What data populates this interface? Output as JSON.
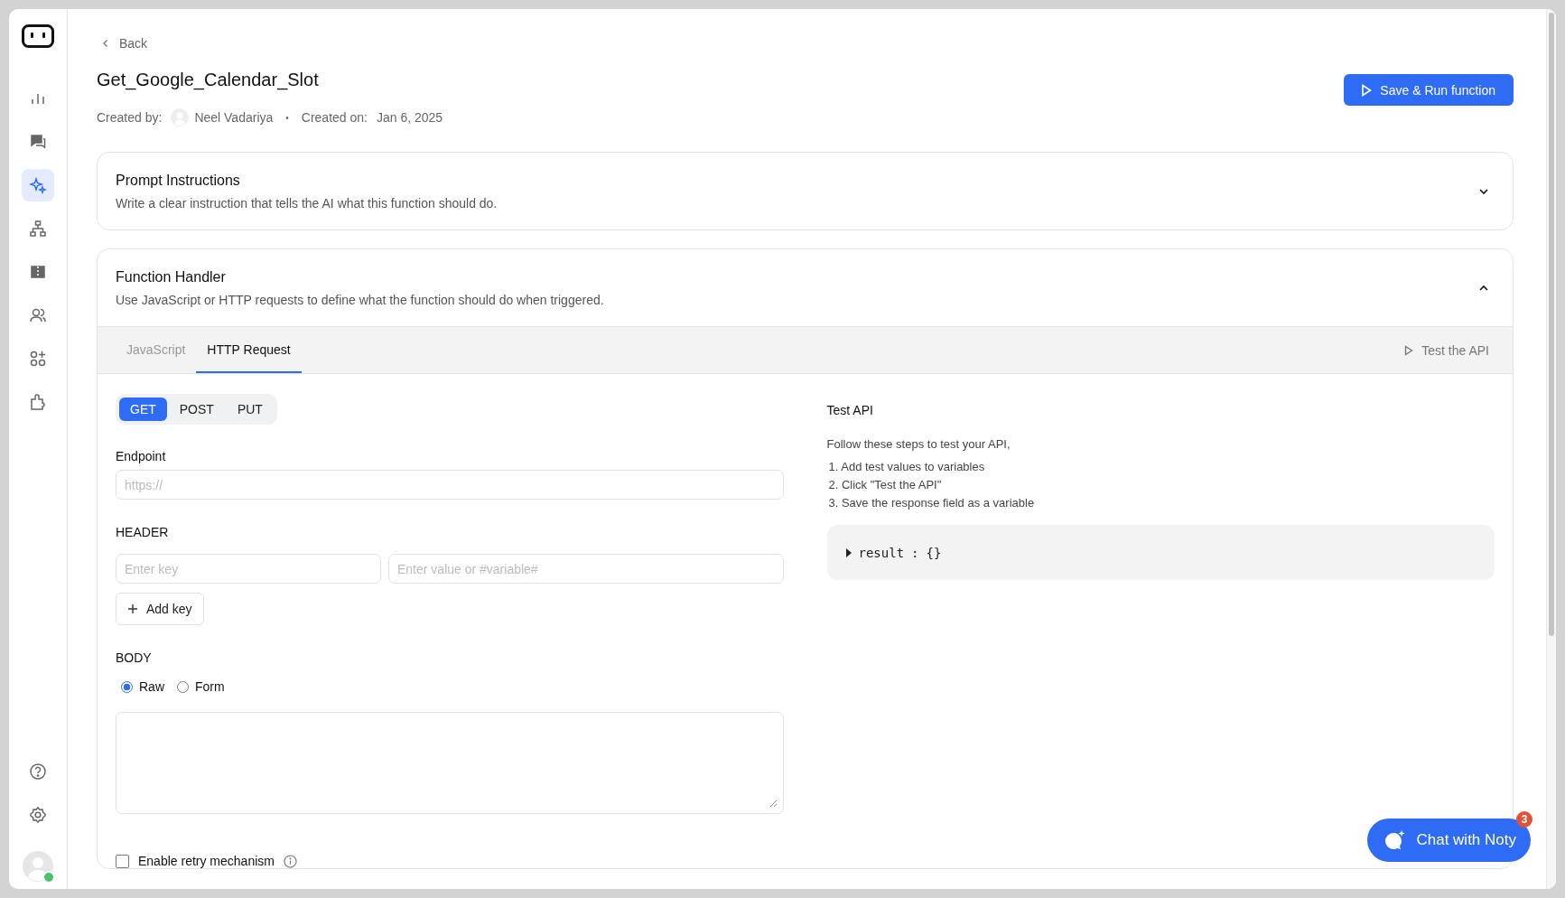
{
  "sidebar": {
    "items": [
      {
        "kind": "chart",
        "selected": false
      },
      {
        "kind": "chat",
        "selected": false
      },
      {
        "kind": "sparkle",
        "selected": true
      },
      {
        "kind": "hierarchy",
        "selected": false
      },
      {
        "kind": "ticket",
        "selected": false
      },
      {
        "kind": "users",
        "selected": false
      },
      {
        "kind": "apps",
        "selected": false
      },
      {
        "kind": "puzzle",
        "selected": false
      }
    ],
    "bottom_items": [
      {
        "kind": "help"
      },
      {
        "kind": "settings"
      }
    ],
    "user": {
      "online": true
    }
  },
  "back": "Back",
  "title": "Get_Google_Calendar_Slot",
  "meta": {
    "created_by_label": "Created by:",
    "author": "Neel Vadariya",
    "separator": "•",
    "created_on_label": "Created on:",
    "created_on": "Jan 6, 2025"
  },
  "primary_button": "Save & Run function",
  "sections": [
    {
      "title": "Prompt Instructions",
      "description": "Write a clear instruction that tells the AI what this function should do.",
      "expanded": false
    },
    {
      "title": "Function Handler",
      "description": "Use JavaScript or HTTP requests to define what the function should do when triggered.",
      "expanded": true
    }
  ],
  "handler": {
    "tabs": [
      {
        "label": "JavaScript",
        "selected": false
      },
      {
        "label": "HTTP Request",
        "selected": true
      }
    ],
    "test_button": "Test the API",
    "methods": [
      {
        "label": "GET",
        "selected": true
      },
      {
        "label": "POST",
        "selected": false
      },
      {
        "label": "PUT",
        "selected": false
      }
    ],
    "endpoint": {
      "label": "Endpoint",
      "placeholder": "https://"
    },
    "header": {
      "label": "HEADER",
      "key_placeholder": "Enter key",
      "value_placeholder": "Enter value or #variable#",
      "add_button": "Add key"
    },
    "body": {
      "label": "BODY",
      "modes": [
        {
          "label": "Raw",
          "selected": true
        },
        {
          "label": "Form",
          "selected": false
        }
      ]
    },
    "retry": {
      "label": "Enable retry mechanism",
      "checked": false
    },
    "test_panel": {
      "title": "Test API",
      "intro": "Follow these steps to test your API,",
      "steps": [
        "1. Add test values to variables",
        "2. Click \"Test the API\"",
        "3. Save the response field as a variable"
      ],
      "result": {
        "key": "result",
        "separator": ":",
        "value": "{}"
      }
    }
  },
  "chat": {
    "label": "Chat with Noty",
    "badge": "3"
  }
}
